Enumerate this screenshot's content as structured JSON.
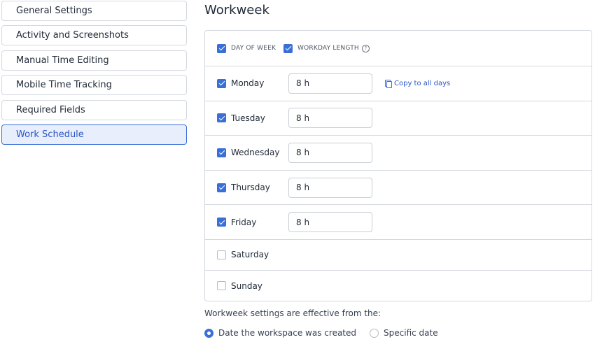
{
  "sidebar": {
    "items": [
      {
        "label": "General Settings",
        "active": false
      },
      {
        "label": "Activity and Screenshots",
        "active": false
      },
      {
        "label": "Manual Time Editing",
        "active": false
      },
      {
        "label": "Mobile Time Tracking",
        "active": false
      },
      {
        "label": "Required Fields",
        "active": false
      },
      {
        "label": "Work Schedule",
        "active": true
      }
    ]
  },
  "main": {
    "title": "Workweek",
    "header": {
      "day_of_week": "DAY OF WEEK",
      "workday_length": "WORKDAY LENGTH",
      "help_icon": "?"
    },
    "copy_to_all": "Copy to all days",
    "days": [
      {
        "name": "Monday",
        "checked": true,
        "hours": "8 h"
      },
      {
        "name": "Tuesday",
        "checked": true,
        "hours": "8 h"
      },
      {
        "name": "Wednesday",
        "checked": true,
        "hours": "8 h"
      },
      {
        "name": "Thursday",
        "checked": true,
        "hours": "8 h"
      },
      {
        "name": "Friday",
        "checked": true,
        "hours": "8 h"
      },
      {
        "name": "Saturday",
        "checked": false,
        "hours": ""
      },
      {
        "name": "Sunday",
        "checked": false,
        "hours": ""
      }
    ],
    "effective_label": "Workweek settings are effective from the:",
    "effective_options": [
      {
        "label": "Date the workspace was created",
        "selected": true
      },
      {
        "label": "Specific date",
        "selected": false
      }
    ]
  },
  "colors": {
    "accent": "#3b6fd8",
    "active_bg": "#e8eefc",
    "border": "#d4d8de"
  }
}
